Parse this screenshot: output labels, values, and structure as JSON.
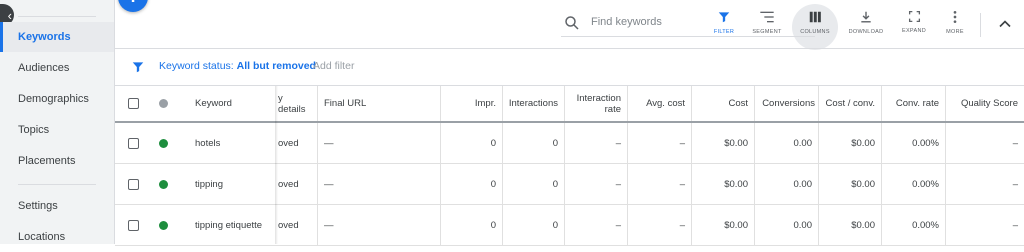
{
  "sidebar": {
    "items": [
      {
        "label": "Keywords",
        "active": true
      },
      {
        "label": "Audiences"
      },
      {
        "label": "Demographics"
      },
      {
        "label": "Topics"
      },
      {
        "label": "Placements"
      },
      {
        "label": "Settings"
      },
      {
        "label": "Locations"
      }
    ]
  },
  "fab": {
    "label": "+"
  },
  "toolbar": {
    "search_placeholder": "Find keywords",
    "filter_label": "FILTER",
    "segment_label": "SEGMENT",
    "columns_label": "COLUMNS",
    "download_label": "DOWNLOAD",
    "expand_label": "EXPAND",
    "more_label": "MORE"
  },
  "filter_bar": {
    "status_prefix": "Keyword status: ",
    "status_value": "All but removed",
    "add_filter": "Add filter"
  },
  "table": {
    "headers": {
      "keyword": "Keyword",
      "policy_details": "y details",
      "final_url": "Final URL",
      "impr": "Impr.",
      "interactions": "Interactions",
      "interaction_rate": "Interaction rate",
      "avg_cost": "Avg. cost",
      "cost": "Cost",
      "conversions": "Conversions",
      "cost_conv": "Cost / conv.",
      "conv_rate": "Conv. rate",
      "quality_score": "Quality Score"
    },
    "rows": [
      {
        "keyword": "hotels",
        "policy": "oved",
        "final_url": "—",
        "impr": "0",
        "interactions": "0",
        "interaction_rate": "–",
        "avg_cost": "–",
        "cost": "$0.00",
        "conversions": "0.00",
        "cost_conv": "$0.00",
        "conv_rate": "0.00%",
        "quality_score": "–"
      },
      {
        "keyword": "tipping",
        "policy": "oved",
        "final_url": "—",
        "impr": "0",
        "interactions": "0",
        "interaction_rate": "–",
        "avg_cost": "–",
        "cost": "$0.00",
        "conversions": "0.00",
        "cost_conv": "$0.00",
        "conv_rate": "0.00%",
        "quality_score": "–"
      },
      {
        "keyword": "tipping etiquette",
        "policy": "oved",
        "final_url": "—",
        "impr": "0",
        "interactions": "0",
        "interaction_rate": "–",
        "avg_cost": "–",
        "cost": "$0.00",
        "conversions": "0.00",
        "cost_conv": "$0.00",
        "conv_rate": "0.00%",
        "quality_score": "–"
      }
    ]
  },
  "colors": {
    "accent": "#1a73e8",
    "enabled_dot": "#1e8e3e",
    "header_dot": "#9aa0a6"
  }
}
